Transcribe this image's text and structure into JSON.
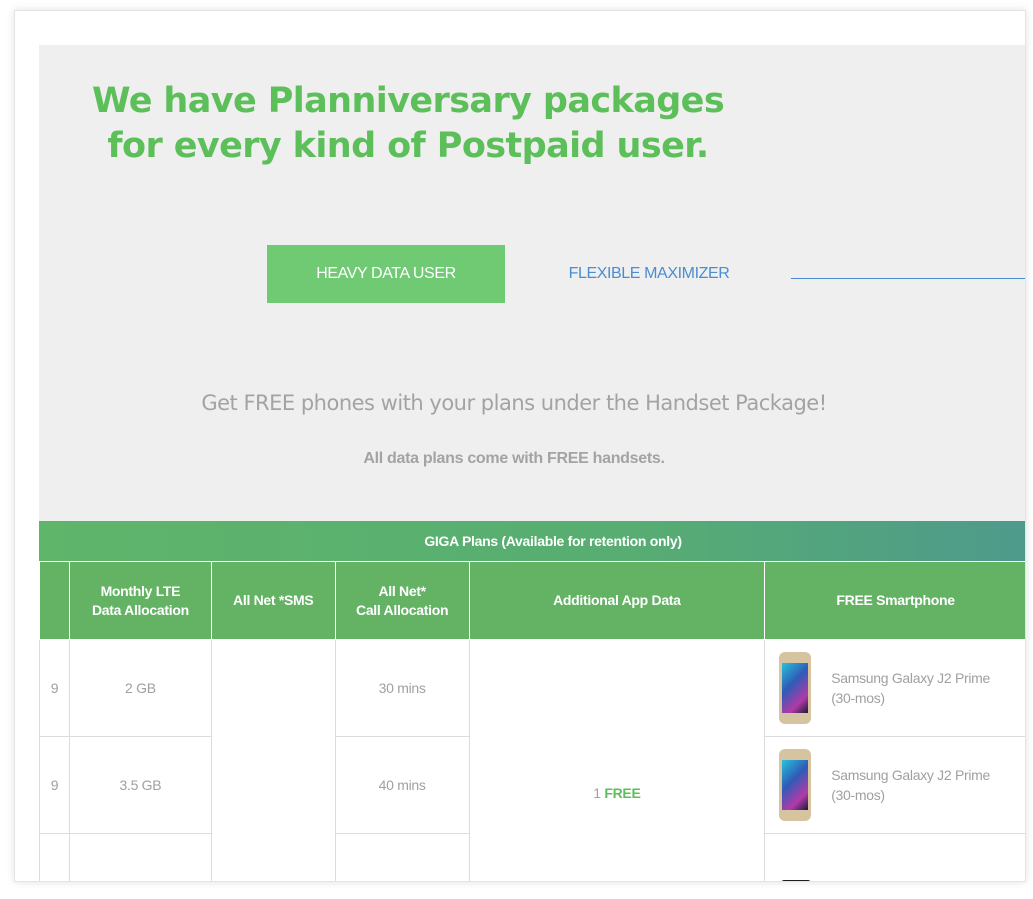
{
  "headline": {
    "line1": "We have Planniversary packages",
    "line2": "for every kind of Postpaid user."
  },
  "tabs": {
    "active": "HEAVY DATA USER",
    "inactive": "FLEXIBLE MAXIMIZER"
  },
  "promo": {
    "title": "Get FREE phones with your plans under the Handset Package!",
    "subtitle": "All data plans come with FREE handsets."
  },
  "table": {
    "title": "GIGA Plans (Available for retention only)",
    "headers": {
      "data": "Monthly LTE\nData Allocation",
      "sms": "All Net *SMS",
      "call": "All Net*\nCall Allocation",
      "apps": "Additional App Data",
      "phone": "FREE Smartphone"
    },
    "rows": [
      {
        "price_cut": "9",
        "data": "2 GB",
        "call": "30 mins",
        "phone_line1": "Samsung Galaxy J2 Prime",
        "phone_line2": "(30-mos)"
      },
      {
        "price_cut": "9",
        "data": "3.5 GB",
        "call": "40 mins",
        "phone_line1": "Samsung Galaxy J2 Prime",
        "phone_line2": "(30-mos)"
      }
    ],
    "app_data": {
      "count": "1",
      "label": "FREE"
    }
  },
  "colors": {
    "brand_green": "#5cbf5a",
    "button_green": "#6fca73",
    "link_blue": "#4a8dd1",
    "panel_bg": "#efefef"
  }
}
